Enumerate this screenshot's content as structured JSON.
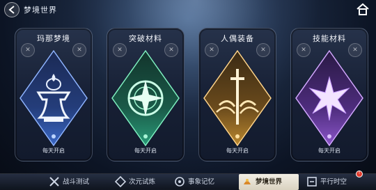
{
  "header": {
    "title": "梦境世界",
    "back_icon": "back-arrow-icon",
    "home_icon": "home-icon"
  },
  "cards": [
    {
      "title": "玛那梦境",
      "footer": "每天开启",
      "emblem": "fountain-icon",
      "accent": "#6aa8ff"
    },
    {
      "title": "突破材料",
      "footer": "每天开启",
      "emblem": "compass-star-icon",
      "accent": "#5fe0a0"
    },
    {
      "title": "人偶装备",
      "footer": "每天开启",
      "emblem": "sword-crest-icon",
      "accent": "#f0b85a"
    },
    {
      "title": "技能材料",
      "footer": "每天开启",
      "emblem": "lotus-star-icon",
      "accent": "#c28bff"
    }
  ],
  "nav": {
    "items": [
      {
        "label": "战斗测试",
        "icon": "crossed-swords-icon"
      },
      {
        "label": "次元试炼",
        "icon": "dimension-icon"
      },
      {
        "label": "事象记忆",
        "icon": "memory-icon"
      },
      {
        "label": "梦境世界",
        "icon": "dream-icon",
        "active": true
      },
      {
        "label": "平行时空",
        "icon": "parallel-icon"
      }
    ],
    "notification": "!"
  }
}
